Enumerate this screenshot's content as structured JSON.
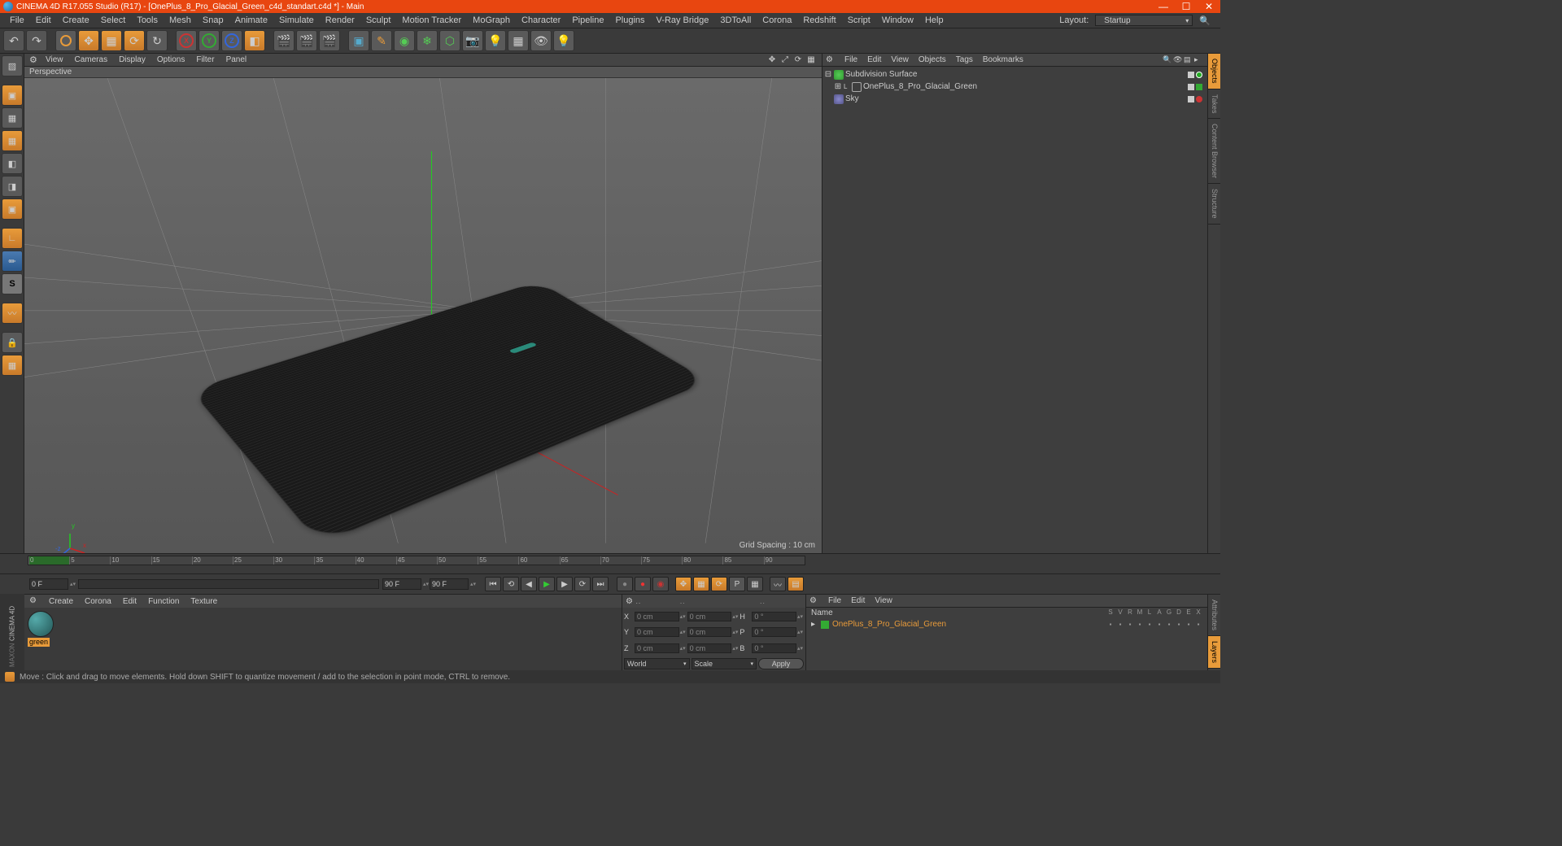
{
  "titlebar": {
    "title": "CINEMA 4D R17.055 Studio (R17) - [OnePlus_8_Pro_Glacial_Green_c4d_standart.c4d *] - Main"
  },
  "menubar": {
    "items": [
      "File",
      "Edit",
      "Create",
      "Select",
      "Tools",
      "Mesh",
      "Snap",
      "Animate",
      "Simulate",
      "Render",
      "Sculpt",
      "Motion Tracker",
      "MoGraph",
      "Character",
      "Pipeline",
      "Plugins",
      "V-Ray Bridge",
      "3DToAll",
      "Corona",
      "Redshift",
      "Script",
      "Window",
      "Help"
    ],
    "layout_label": "Layout:",
    "layout_value": "Startup"
  },
  "viewport": {
    "menu": [
      "View",
      "Cameras",
      "Display",
      "Options",
      "Filter",
      "Panel"
    ],
    "label": "Perspective",
    "grid_spacing": "Grid Spacing : 10 cm"
  },
  "object_panel": {
    "menu": [
      "File",
      "Edit",
      "View",
      "Objects",
      "Tags",
      "Bookmarks"
    ],
    "tree": [
      {
        "name": "Subdivision Surface",
        "icon": "subsurf",
        "expanded": true,
        "tags": [
          "on",
          "g"
        ]
      },
      {
        "name": "OnePlus_8_Pro_Glacial_Green",
        "icon": "null",
        "child": true,
        "tags": [
          "on",
          "g"
        ]
      },
      {
        "name": "Sky",
        "icon": "sky",
        "tags": [
          "on",
          "r"
        ]
      }
    ]
  },
  "right_tabs": [
    "Objects",
    "Takes",
    "Content Browser",
    "Structure"
  ],
  "right_tabs_lower": [
    "Attributes",
    "Layers"
  ],
  "timeline": {
    "ticks": [
      "0",
      "5",
      "10",
      "15",
      "20",
      "25",
      "30",
      "35",
      "40",
      "45",
      "50",
      "55",
      "60",
      "65",
      "70",
      "75",
      "80",
      "85",
      "90"
    ],
    "end_label": "90 F",
    "start_input": "0 F",
    "end_input": "0 F",
    "mid_input": "90 F",
    "mid_input2": "90 F"
  },
  "material": {
    "menu": [
      "Create",
      "Corona",
      "Edit",
      "Function",
      "Texture"
    ],
    "item_name": "green",
    "maxon": "CINEMA 4D",
    "maxon2": "MAXON"
  },
  "coords": {
    "rows": [
      {
        "axis": "X",
        "pos": "0 cm",
        "size": "0 cm",
        "rot_label": "H",
        "rot": "0 °"
      },
      {
        "axis": "Y",
        "pos": "0 cm",
        "size": "0 cm",
        "rot_label": "P",
        "rot": "0 °"
      },
      {
        "axis": "Z",
        "pos": "0 cm",
        "size": "0 cm",
        "rot_label": "B",
        "rot": "0 °"
      }
    ],
    "world": "World",
    "scale": "Scale",
    "apply": "Apply"
  },
  "attributes": {
    "menu": [
      "File",
      "Edit",
      "View"
    ],
    "name_label": "Name",
    "layer_name": "OnePlus_8_Pro_Glacial_Green",
    "col_labels": [
      "S",
      "V",
      "R",
      "M",
      "L",
      "A",
      "G",
      "D",
      "E",
      "X"
    ]
  },
  "status": {
    "text": "Move : Click and drag to move elements. Hold down SHIFT to quantize movement / add to the selection in point mode, CTRL to remove."
  }
}
